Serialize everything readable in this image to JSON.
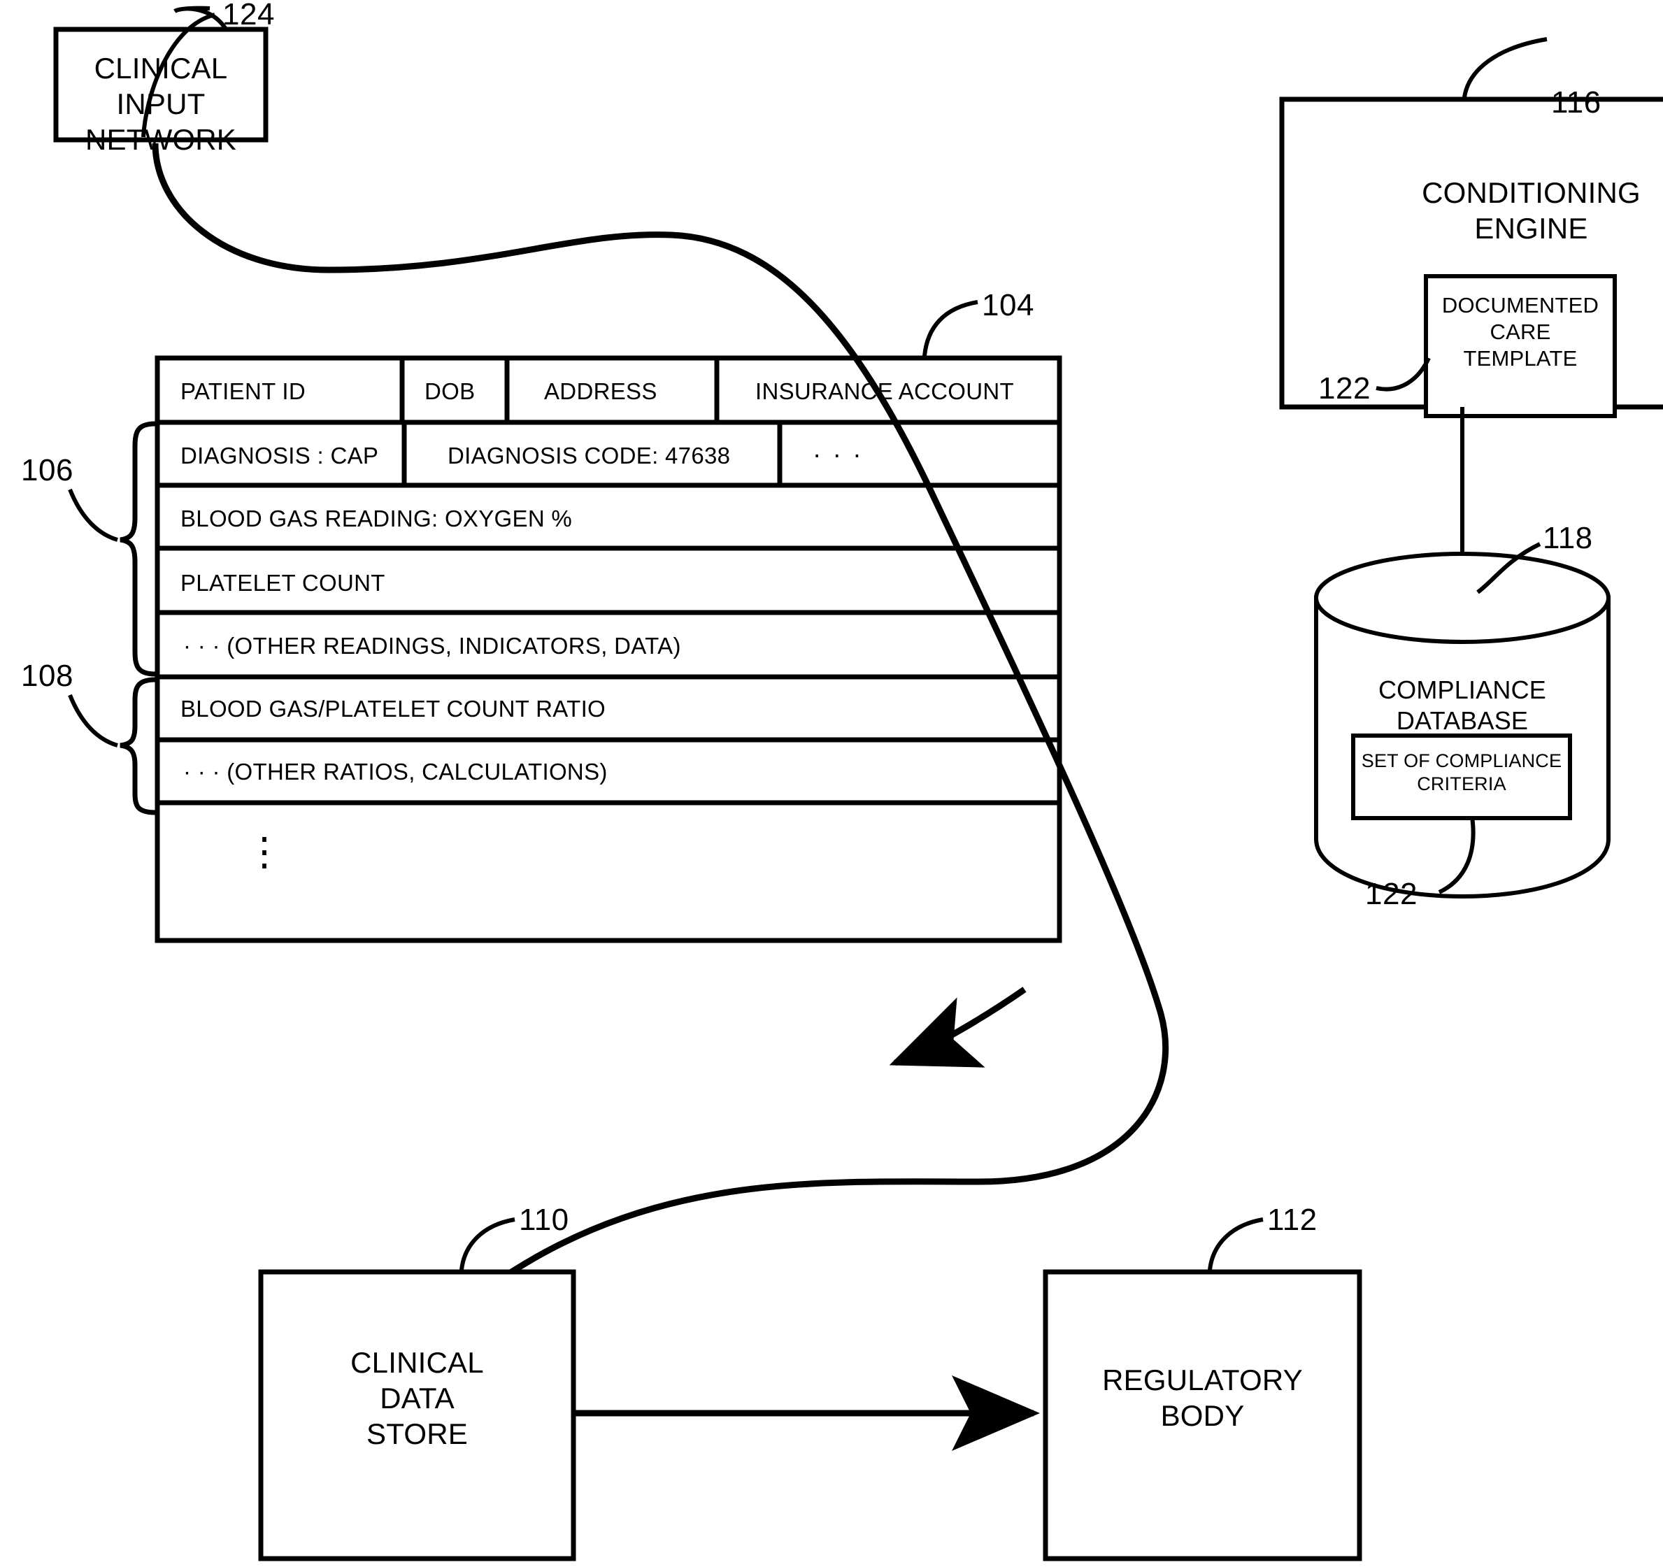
{
  "figure": {
    "nodes": {
      "clinical_input_network": {
        "label": "CLINICAL\nINPUT\nNETWORK",
        "ref": "124"
      },
      "conditioning_engine": {
        "label": "CONDITIONING\nENGINE",
        "ref": "116"
      },
      "documented_care_template": {
        "label": "DOCUMENTED\nCARE\nTEMPLATE",
        "ref": "122"
      },
      "compliance_database": {
        "label": "COMPLIANCE\nDATABASE",
        "ref": "118"
      },
      "set_of_compliance_criteria": {
        "label": "SET OF COMPLIANCE\nCRITERIA",
        "ref": "122"
      },
      "clinical_data_store": {
        "label": "CLINICAL\nDATA\nSTORE",
        "ref": "110"
      },
      "regulatory_body": {
        "label": "REGULATORY\nBODY",
        "ref": "112"
      },
      "patient_record_table": {
        "ref": "104"
      }
    },
    "node_labels": {
      "cin_line1": "CLINICAL",
      "cin_line2": "INPUT",
      "cin_line3": "NETWORK",
      "ce_line1": "CONDITIONING",
      "ce_line2": "ENGINE",
      "dct_line1": "DOCUMENTED",
      "dct_line2": "CARE",
      "dct_line3": "TEMPLATE",
      "cdb_line1": "COMPLIANCE",
      "cdb_line2": "DATABASE",
      "socc_line1": "SET OF COMPLIANCE",
      "socc_line2": "CRITERIA",
      "cds_line1": "CLINICAL",
      "cds_line2": "DATA",
      "cds_line3": "STORE",
      "rb_line1": "REGULATORY",
      "rb_line2": "BODY"
    },
    "reference_numerals": {
      "n124": "124",
      "n116": "116",
      "n104": "104",
      "n106": "106",
      "n108": "108",
      "n122_template": "122",
      "n118": "118",
      "n122_criteria": "122",
      "n110": "110",
      "n112": "112"
    },
    "table": {
      "ref": "104",
      "brace_upper_ref": "106",
      "brace_lower_ref": "108",
      "rows": [
        {
          "name": "header-row",
          "cells": [
            {
              "text": "PATIENT ID"
            },
            {
              "text": "DOB"
            },
            {
              "text": "ADDRESS"
            },
            {
              "text": "INSURANCE ACCOUNT"
            }
          ]
        },
        {
          "name": "diagnosis-row",
          "cells": [
            {
              "text": "DIAGNOSIS :  CAP"
            },
            {
              "text": "DIAGNOSIS CODE:  47638"
            },
            {
              "text": "· · ·"
            }
          ]
        },
        {
          "name": "blood-gas-row",
          "cells": [
            {
              "text": "BLOOD GAS READING:    OXYGEN %"
            }
          ]
        },
        {
          "name": "platelet-row",
          "cells": [
            {
              "text": "PLATELET COUNT"
            }
          ]
        },
        {
          "name": "other-readings-row",
          "cells": [
            {
              "text": "· · ·  (OTHER READINGS, INDICATORS, DATA)"
            }
          ]
        },
        {
          "name": "ratio-row",
          "cells": [
            {
              "text": "BLOOD GAS/PLATELET COUNT RATIO"
            }
          ]
        },
        {
          "name": "other-ratios-row",
          "cells": [
            {
              "text": "· · ·  (OTHER RATIOS, CALCULATIONS)"
            }
          ]
        },
        {
          "name": "ellipsis-row",
          "cells": [
            {
              "text": "⋮"
            }
          ]
        }
      ]
    },
    "colors": {
      "stroke": "#000000",
      "background": "#ffffff"
    }
  }
}
